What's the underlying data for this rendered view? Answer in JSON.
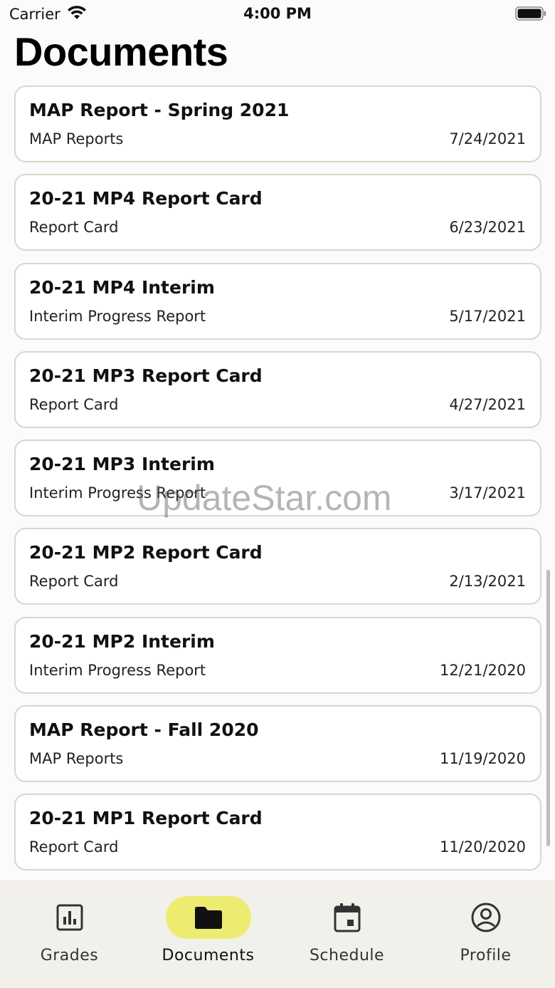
{
  "status_bar": {
    "carrier": "Carrier",
    "time": "4:00 PM"
  },
  "header": {
    "title": "Documents"
  },
  "documents": [
    {
      "title": "MAP Report - Spring 2021",
      "type": "MAP Reports",
      "date": "7/24/2021"
    },
    {
      "title": "20-21 MP4 Report Card",
      "type": "Report Card",
      "date": "6/23/2021"
    },
    {
      "title": "20-21 MP4 Interim",
      "type": "Interim Progress Report",
      "date": "5/17/2021"
    },
    {
      "title": "20-21 MP3 Report Card",
      "type": "Report Card",
      "date": "4/27/2021"
    },
    {
      "title": "20-21 MP3 Interim",
      "type": "Interim Progress Report",
      "date": "3/17/2021"
    },
    {
      "title": "20-21 MP2 Report Card",
      "type": "Report Card",
      "date": "2/13/2021"
    },
    {
      "title": "20-21 MP2 Interim",
      "type": "Interim Progress Report",
      "date": "12/21/2020"
    },
    {
      "title": "MAP Report - Fall 2020",
      "type": "MAP Reports",
      "date": "11/19/2020"
    },
    {
      "title": "20-21 MP1 Report Card",
      "type": "Report Card",
      "date": "11/20/2020"
    }
  ],
  "watermark": "UpdateStar.com",
  "tab_bar": {
    "tabs": [
      {
        "label": "Grades",
        "icon": "chart-icon"
      },
      {
        "label": "Documents",
        "icon": "folder-icon",
        "active": true
      },
      {
        "label": "Schedule",
        "icon": "calendar-icon"
      },
      {
        "label": "Profile",
        "icon": "profile-icon"
      }
    ]
  },
  "colors": {
    "accent": "#ecec70",
    "card_border": "#d9d6c9",
    "tab_bar_bg": "#f2f0ea"
  }
}
